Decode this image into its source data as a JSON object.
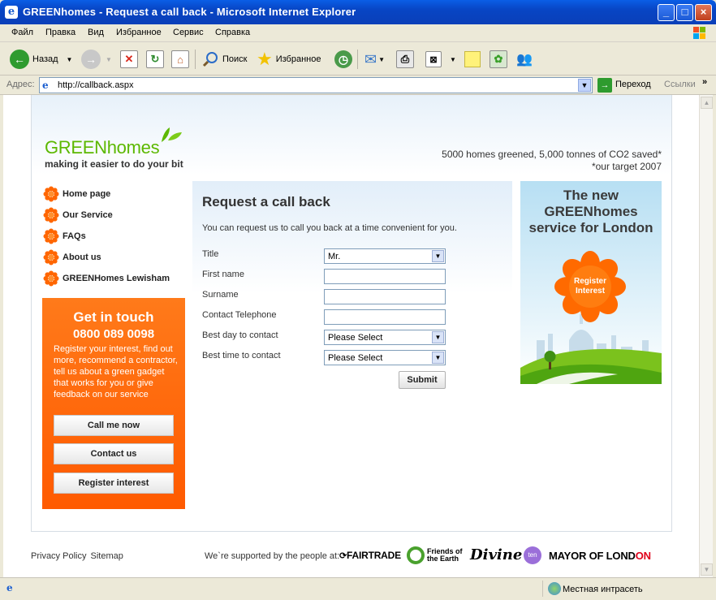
{
  "window": {
    "title": "GREENhomes - Request a call back - Microsoft Internet Explorer",
    "controls": [
      "_",
      "□",
      "×"
    ]
  },
  "menu": [
    "Файл",
    "Правка",
    "Вид",
    "Избранное",
    "Сервис",
    "Справка"
  ],
  "toolbar": {
    "back_label": "Назад",
    "search_label": "Поиск",
    "favorites_label": "Избранное"
  },
  "address": {
    "label": "Адрес:",
    "url": "http://callback.aspx",
    "go_label": "Переход",
    "links_label": "Ссылки",
    "chevron": "»"
  },
  "header": {
    "logo_green": "GREEN",
    "logo_homes": "homes",
    "tagline": "making it easier to do your bit",
    "stat_line1": "5000 homes greened, 5,000 tonnes of CO2 saved*",
    "stat_line2": "*our target 2007"
  },
  "nav": [
    {
      "label": "Home page"
    },
    {
      "label": "Our Service"
    },
    {
      "label": "FAQs"
    },
    {
      "label": "About us"
    },
    {
      "label": "GREENHomes Lewisham"
    }
  ],
  "get_in_touch": {
    "heading": "Get in touch",
    "phone": "0800 089 0098",
    "description": "Register your interest, find out more, recommend a contractor, tell us about a green gadget that works for you or give feedback on our service",
    "buttons": [
      "Call me now",
      "Contact us",
      "Register interest"
    ]
  },
  "form": {
    "title": "Request a call back",
    "intro": "You can request us to call you back at a time convenient for you.",
    "fields": [
      {
        "label": "Title",
        "value": "Mr.",
        "type": "select"
      },
      {
        "label": "First name",
        "value": "",
        "type": "text"
      },
      {
        "label": "Surname",
        "value": "",
        "type": "text"
      },
      {
        "label": "Contact Telephone",
        "value": "",
        "type": "text"
      },
      {
        "label": "Best day to contact",
        "value": "Please Select",
        "type": "select"
      },
      {
        "label": "Best time to contact",
        "value": "Please Select",
        "type": "select"
      }
    ],
    "submit_label": "Submit"
  },
  "promo": {
    "title": "The new GREENhomes service for London",
    "badge": "Register Interest"
  },
  "footer": {
    "privacy": "Privacy Policy",
    "sitemap": "Sitemap",
    "supported": "We`re supported by the people at:",
    "sponsors": {
      "fairtrade": "FAIRTRADE",
      "foe_line1": "Friends of",
      "foe_line2": "the Earth",
      "divine": "Divine",
      "ten": "ten",
      "mayor_a": "MAYOR OF LOND",
      "mayor_b": "ON"
    }
  },
  "status": {
    "zone": "Местная интрасеть"
  },
  "colors": {
    "brand_green": "#5cb800",
    "orange": "#ff6600",
    "xp_blue": "#0a5ee6"
  }
}
